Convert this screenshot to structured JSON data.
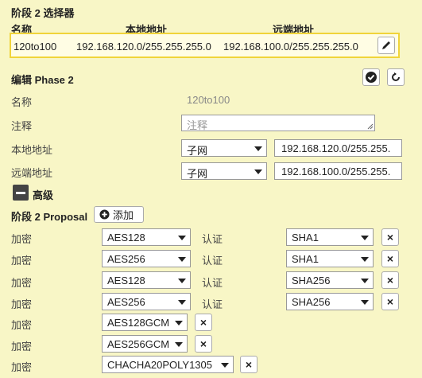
{
  "selectors": {
    "title": "阶段 2 选择器",
    "headers": {
      "name": "名称",
      "local": "本地地址",
      "remote": "远端地址"
    },
    "row": {
      "name": "120to100",
      "local": "192.168.120.0/255.255.255.0",
      "remote": "192.168.100.0/255.255.255.0"
    }
  },
  "edit": {
    "title": "编辑 Phase 2",
    "name_label": "名称",
    "name_value": "120to100",
    "comment_label": "注释",
    "comment_placeholder": "注释",
    "local_label": "本地地址",
    "local_type": "子网",
    "local_value": "192.168.120.0/255.255.",
    "remote_label": "远端地址",
    "remote_type": "子网",
    "remote_value": "192.168.100.0/255.255.",
    "advanced_label": "高级"
  },
  "proposal": {
    "title": "阶段 2 Proposal",
    "add_label": "添加",
    "encrypt_label": "加密",
    "auth_label": "认证",
    "rows": [
      {
        "enc": "AES128",
        "auth": "SHA1"
      },
      {
        "enc": "AES256",
        "auth": "SHA1"
      },
      {
        "enc": "AES128",
        "auth": "SHA256"
      },
      {
        "enc": "AES256",
        "auth": "SHA256"
      },
      {
        "enc": "AES128GCM"
      },
      {
        "enc": "AES256GCM"
      },
      {
        "enc": "CHACHA20POLY1305"
      }
    ]
  },
  "icons": {
    "remove": "×",
    "edit": "pencil-icon",
    "ok": "check-circle-icon",
    "undo": "undo-icon",
    "add": "plus-circle-icon"
  }
}
